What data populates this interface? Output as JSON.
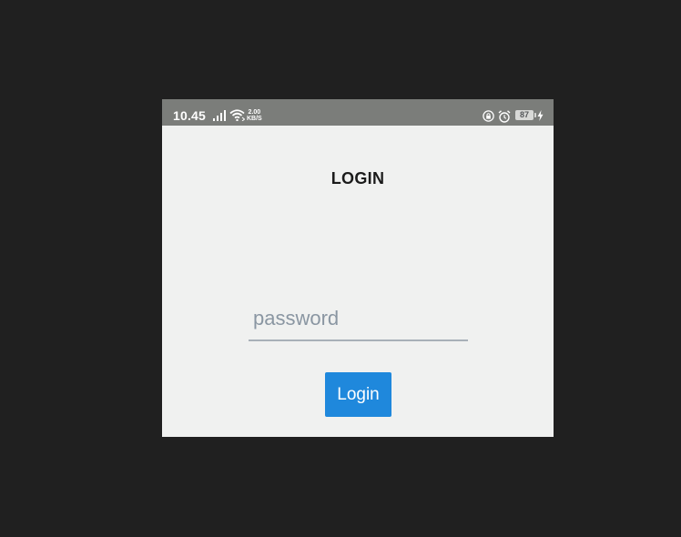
{
  "status_bar": {
    "time": "10.45",
    "net_speed_value": "2.00",
    "net_speed_unit": "KB/S",
    "battery_level": "87",
    "icons": [
      "signal-icon",
      "wifi-icon",
      "lock-rotate-icon",
      "alarm-icon",
      "battery-icon",
      "charge-icon"
    ]
  },
  "page": {
    "title": "LOGIN"
  },
  "form": {
    "password_placeholder": "password",
    "password_value": "",
    "login_label": "Login"
  },
  "colors": {
    "background": "#202020",
    "screen": "#f0f1f0",
    "status_bar": "#7b7d7a",
    "accent": "#1f88dc"
  }
}
